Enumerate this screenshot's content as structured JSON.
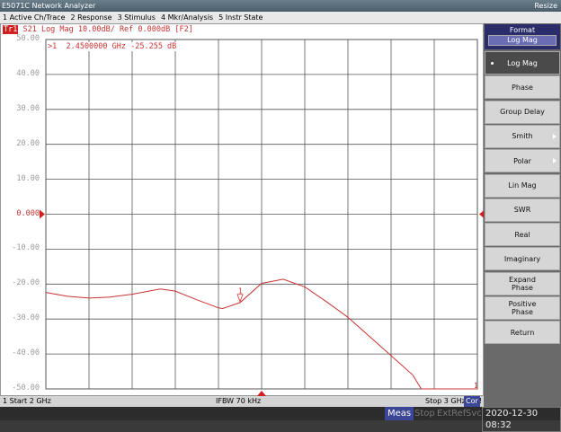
{
  "window": {
    "title": "E5071C Network Analyzer",
    "resize": "Resize"
  },
  "menu": [
    "1 Active Ch/Trace",
    "2 Response",
    "3 Stimulus",
    "4 Mkr/Analysis",
    "5 Instr State"
  ],
  "trace": {
    "id": "Tr1",
    "header": " S21 Log Mag 10.00dB/ Ref 0.000dB [F2]",
    "color": "#c83232"
  },
  "marker": {
    "readout": ">1  2.4500000 GHz -25.255 dB",
    "label": "1",
    "end_label": "1"
  },
  "status": {
    "start": "1  Start 2 GHz",
    "ifbw": "IFBW 70 kHz",
    "stop": "Stop 3 GHz",
    "cor": "Cor",
    "excl": "!"
  },
  "bottom": {
    "meas": "Meas",
    "stop": "Stop",
    "extref": "ExtRef",
    "svc": "Svc",
    "datetime": "2020-12-30 08:32"
  },
  "softkeys": {
    "title": "Format",
    "current": "Log Mag",
    "items": [
      {
        "label": "Log Mag",
        "selected": true
      },
      {
        "label": "Phase"
      },
      {
        "label": "Group Delay"
      },
      {
        "label": "Smith",
        "submenu": true
      },
      {
        "label": "Polar",
        "submenu": true
      },
      {
        "label": "Lin Mag"
      },
      {
        "label": "SWR"
      },
      {
        "label": "Real"
      },
      {
        "label": "Imaginary"
      },
      {
        "label": "Expand\nPhase"
      },
      {
        "label": "Positive\nPhase"
      },
      {
        "label": "Return"
      }
    ]
  },
  "chart_data": {
    "type": "line",
    "xlabel": "",
    "ylabel": "",
    "xlim": [
      2.0,
      3.0
    ],
    "ylim": [
      -50,
      50
    ],
    "yticks": [
      "50.00",
      "40.00",
      "30.00",
      "20.00",
      "10.00",
      "0.000",
      "-10.00",
      "-20.00",
      "-30.00",
      "-40.00",
      "-50.00"
    ],
    "grid": true,
    "x_unit": "GHz",
    "y_unit": "dB",
    "x": [
      2.0,
      2.05,
      2.1,
      2.15,
      2.2,
      2.265,
      2.3,
      2.35,
      2.4,
      2.41,
      2.45,
      2.5,
      2.55,
      2.6,
      2.65,
      2.7,
      2.75,
      2.8,
      2.85,
      2.87,
      2.9,
      3.0
    ],
    "y": [
      -22.4,
      -23.5,
      -24.0,
      -23.7,
      -22.9,
      -21.4,
      -22.0,
      -24.5,
      -26.8,
      -27.0,
      -25.3,
      -19.8,
      -18.6,
      -20.8,
      -25.0,
      -29.5,
      -35.0,
      -40.5,
      -46.0,
      -50,
      -50,
      -50
    ],
    "marker": {
      "x": 2.45,
      "y": -25.255
    }
  }
}
